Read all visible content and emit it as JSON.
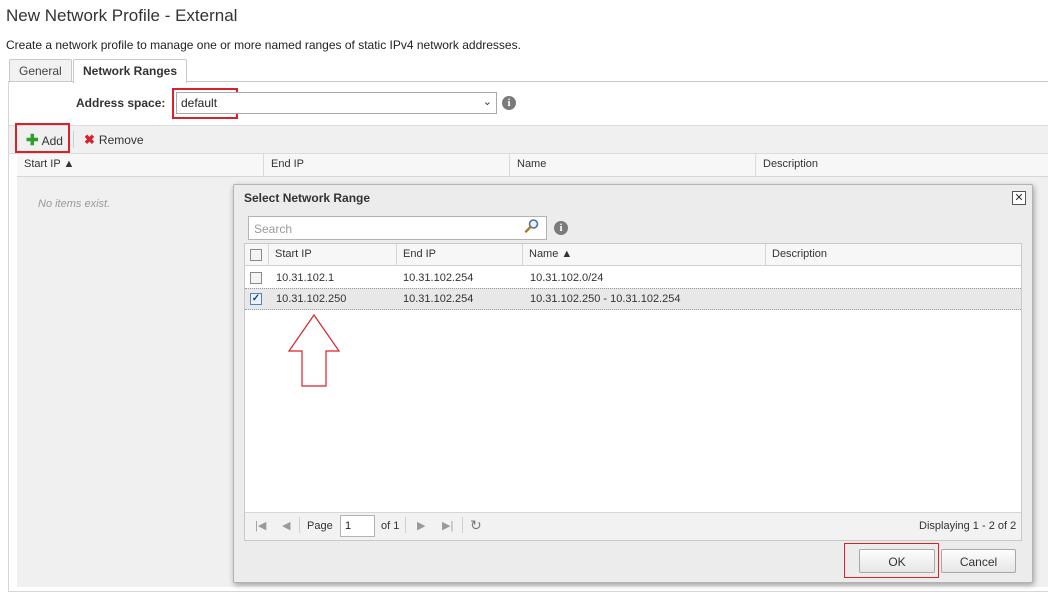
{
  "window": {
    "title": "New Network Profile - External",
    "subtitle": "Create a network profile to manage one or more named ranges of static IPv4 network addresses."
  },
  "tabs": [
    {
      "label": "General",
      "active": false
    },
    {
      "label": "Network Ranges",
      "active": true
    }
  ],
  "address_space": {
    "label": "Address space:",
    "value": "default"
  },
  "toolbar": {
    "add_label": "Add",
    "remove_label": "Remove"
  },
  "grid": {
    "columns": [
      "Start IP ▲",
      "End IP",
      "Name",
      "Description"
    ],
    "empty_text": "No items exist."
  },
  "dialog": {
    "title": "Select Network Range",
    "close_glyph": "✕",
    "search_placeholder": "Search",
    "columns": [
      "Start IP",
      "End IP",
      "Name ▲",
      "Description"
    ],
    "rows": [
      {
        "start_ip": "10.31.102.1",
        "end_ip": "10.31.102.254",
        "name": "10.31.102.0/24",
        "description": "",
        "checked": false
      },
      {
        "start_ip": "10.31.102.250",
        "end_ip": "10.31.102.254",
        "name": "10.31.102.250 - 10.31.102.254",
        "description": "",
        "checked": true
      }
    ],
    "pager": {
      "page_label": "Page",
      "page_value": "1",
      "of_label": "of 1",
      "displaying": "Displaying 1 - 2 of 2"
    },
    "ok_label": "OK",
    "cancel_label": "Cancel"
  },
  "colors": {
    "highlight_red": "#d9212b",
    "add_green": "#2f9e2f"
  },
  "icons": [
    "info-icon",
    "chevron-down-icon",
    "plus-icon",
    "remove-x-icon",
    "search-magnifier-icon",
    "close-icon",
    "first-page-icon",
    "prev-page-icon",
    "next-page-icon",
    "last-page-icon",
    "refresh-icon",
    "up-arrow-annotation-icon"
  ]
}
